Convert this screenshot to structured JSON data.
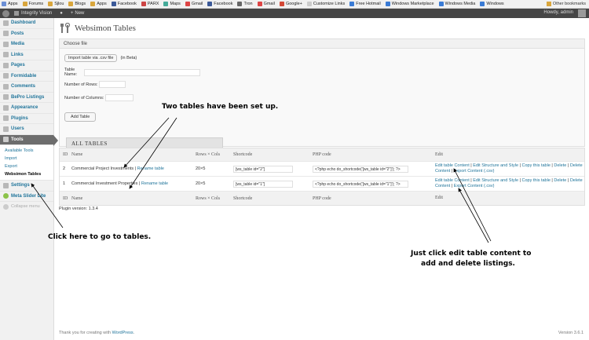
{
  "bookmarks": {
    "items": [
      "Apps",
      "Forums",
      "Sjlou",
      "Blogs",
      "Apps",
      "Facebook",
      "PARX",
      "Maps",
      "Gmail",
      "Facebook",
      "Tron",
      "Gmail",
      "Google+",
      "Customize Links",
      "Free Hotmail",
      "Windows Marketplace",
      "Windows Media",
      "Windows"
    ],
    "other": "Other bookmarks"
  },
  "adminbar": {
    "site": "Integrity Vision",
    "new_label": "New",
    "howdy": "Howdy, admin"
  },
  "sidebar": {
    "items": [
      {
        "label": "Dashboard"
      },
      {
        "label": "Posts"
      },
      {
        "label": "Media"
      },
      {
        "label": "Links"
      },
      {
        "label": "Pages"
      },
      {
        "label": "Formidable"
      },
      {
        "label": "Comments"
      },
      {
        "label": "BePro Listings"
      },
      {
        "label": "Appearance"
      },
      {
        "label": "Plugins"
      },
      {
        "label": "Users"
      },
      {
        "label": "Tools"
      }
    ],
    "submenu": [
      "Available Tools",
      "Import",
      "Export",
      "Websimon Tables"
    ],
    "after": [
      {
        "label": "Settings"
      },
      {
        "label": "Meta Slider Lite"
      }
    ],
    "collapse": "Collapse menu"
  },
  "page": {
    "title": "Websimon Tables",
    "choose_file_header": "Choose file",
    "import_button": "Import table via .csv file",
    "beta": "(in Beta)",
    "table_name_label": "Table Name:",
    "rows_label": "Number of Rows:",
    "cols_label": "Number of Columns:",
    "add_button": "Add Table",
    "all_tables_tab": "ALL TABLES"
  },
  "table": {
    "headers": {
      "id": "ID",
      "name": "Name",
      "rc": "Rows × Cols",
      "shortcode": "Shortcode",
      "php": "PHP code",
      "edit": "Edit"
    },
    "rows": [
      {
        "id": "2",
        "name": "Commercial Project Investments",
        "rename": "Rename table",
        "rc": "20×5",
        "shortcode": "[ws_table id=\"2\"]",
        "php": "<?php echo do_shortcode('[ws_table id=\"2\"]'); ?>",
        "edit_content": "Edit table Content",
        "edit_structure": "Edit Structure and Style",
        "copy": "Copy this table",
        "delete": "Delete",
        "delete_content": "Delete Content",
        "export": "Export Content (.csv)"
      },
      {
        "id": "1",
        "name": "Commercial Investment Properties",
        "rename": "Rename table",
        "rc": "20×5",
        "shortcode": "[ws_table id=\"1\"]",
        "php": "<?php echo do_shortcode('[ws_table id=\"1\"]'); ?>",
        "edit_content": "Edit table Content",
        "edit_structure": "Edit Structure and Style",
        "copy": "Copy this table",
        "delete": "Delete",
        "delete_content": "Delete Content",
        "export": "Export Content (.csv)"
      }
    ]
  },
  "plugin_version": "Plugin version: 1.3.4",
  "footer": {
    "thanks_prefix": "Thank you for creating with ",
    "wordpress": "WordPress",
    "thanks_suffix": ".",
    "version": "Version 3.6.1"
  },
  "annotations": {
    "two_tables": "Two tables have been set up.",
    "click_here": "Click here to go to tables.",
    "edit_line1": "Just click edit table content to",
    "edit_line2": "add and delete listings."
  }
}
